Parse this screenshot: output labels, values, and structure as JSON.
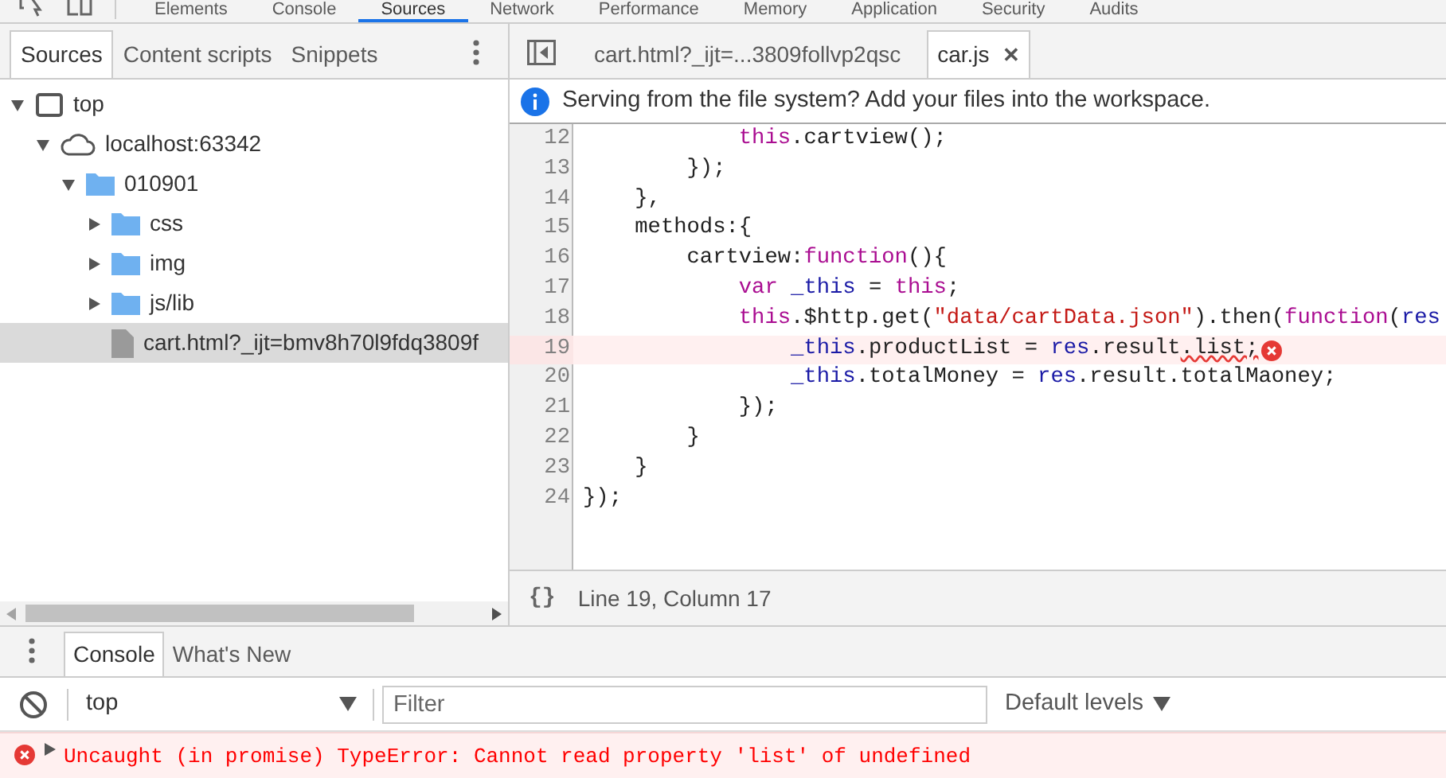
{
  "main_tabs": [
    {
      "label": "Elements",
      "selected": false
    },
    {
      "label": "Console",
      "selected": false
    },
    {
      "label": "Sources",
      "selected": true
    },
    {
      "label": "Network",
      "selected": false
    },
    {
      "label": "Performance",
      "selected": false
    },
    {
      "label": "Memory",
      "selected": false
    },
    {
      "label": "Application",
      "selected": false
    },
    {
      "label": "Security",
      "selected": false
    },
    {
      "label": "Audits",
      "selected": false
    }
  ],
  "navigator": {
    "tabs": [
      {
        "label": "Sources",
        "selected": true
      },
      {
        "label": "Content scripts",
        "selected": false
      },
      {
        "label": "Snippets",
        "selected": false
      }
    ],
    "tree": [
      {
        "kind": "frame",
        "label": "top",
        "expanded": true,
        "selected": false,
        "children": [
          {
            "kind": "domain",
            "label": "localhost:63342",
            "expanded": true,
            "selected": false,
            "children": [
              {
                "kind": "folder",
                "label": "010901",
                "expanded": true,
                "selected": false,
                "children": [
                  {
                    "kind": "folder",
                    "label": "css",
                    "expanded": false,
                    "selected": false
                  },
                  {
                    "kind": "folder",
                    "label": "img",
                    "expanded": false,
                    "selected": false
                  },
                  {
                    "kind": "folder",
                    "label": "js/lib",
                    "expanded": false,
                    "selected": false
                  },
                  {
                    "kind": "file",
                    "label": "cart.html?_ijt=bmv8h70l9fdq3809f",
                    "selected": true
                  }
                ]
              }
            ]
          }
        ]
      }
    ]
  },
  "editor": {
    "tabs": [
      {
        "label": "cart.html?_ijt=...3809follvp2qsc",
        "selected": false,
        "closable": false
      },
      {
        "label": "car.js",
        "selected": true,
        "closable": true
      }
    ],
    "close_glyph": "✕",
    "infobar": "Serving from the file system? Add your files into the workspace.",
    "lines": [
      {
        "number": "12",
        "error": false,
        "tokens": [
          {
            "kind": "keyword",
            "text": "            this"
          },
          {
            "kind": "plain",
            "text": ".cartview();"
          }
        ]
      },
      {
        "number": "13",
        "error": false,
        "tokens": [
          {
            "kind": "plain",
            "text": "        });"
          }
        ]
      },
      {
        "number": "14",
        "error": false,
        "tokens": [
          {
            "kind": "plain",
            "text": "    },"
          }
        ]
      },
      {
        "number": "15",
        "error": false,
        "tokens": [
          {
            "kind": "plain",
            "text": "    methods:{"
          }
        ]
      },
      {
        "number": "16",
        "error": false,
        "tokens": [
          {
            "kind": "plain",
            "text": "        cartview:"
          },
          {
            "kind": "keyword",
            "text": "function"
          },
          {
            "kind": "plain",
            "text": "(){"
          }
        ]
      },
      {
        "number": "17",
        "error": false,
        "tokens": [
          {
            "kind": "keyword",
            "text": "            var "
          },
          {
            "kind": "variable",
            "text": "_this"
          },
          {
            "kind": "plain",
            "text": " = "
          },
          {
            "kind": "keyword",
            "text": "this"
          },
          {
            "kind": "plain",
            "text": ";"
          }
        ]
      },
      {
        "number": "18",
        "error": false,
        "tokens": [
          {
            "kind": "keyword",
            "text": "            this"
          },
          {
            "kind": "plain",
            "text": ".$http.get("
          },
          {
            "kind": "string",
            "text": "\"data/cartData.json\""
          },
          {
            "kind": "plain",
            "text": ").then("
          },
          {
            "kind": "keyword",
            "text": "function"
          },
          {
            "kind": "plain",
            "text": "("
          },
          {
            "kind": "variable",
            "text": "res"
          }
        ]
      },
      {
        "number": "19",
        "error": true,
        "tokens": [
          {
            "kind": "variable",
            "text": "                _this"
          },
          {
            "kind": "plain",
            "text": ".productList = "
          },
          {
            "kind": "variable",
            "text": "res"
          },
          {
            "kind": "plain",
            "text": ".result"
          },
          {
            "kind": "squiggle",
            "text": ".list;"
          }
        ]
      },
      {
        "number": "20",
        "error": false,
        "tokens": [
          {
            "kind": "variable",
            "text": "                _this"
          },
          {
            "kind": "plain",
            "text": ".totalMoney = "
          },
          {
            "kind": "variable",
            "text": "res"
          },
          {
            "kind": "plain",
            "text": ".result.totalMaoney;"
          }
        ]
      },
      {
        "number": "21",
        "error": false,
        "tokens": [
          {
            "kind": "plain",
            "text": "            });"
          }
        ]
      },
      {
        "number": "22",
        "error": false,
        "tokens": [
          {
            "kind": "plain",
            "text": "        }"
          }
        ]
      },
      {
        "number": "23",
        "error": false,
        "tokens": [
          {
            "kind": "plain",
            "text": "    }"
          }
        ]
      },
      {
        "number": "24",
        "error": false,
        "tokens": [
          {
            "kind": "plain",
            "text": "});"
          }
        ]
      }
    ],
    "pretty_print": "{}",
    "status": "Line 19, Column 17"
  },
  "drawer": {
    "tabs": [
      {
        "label": "Console",
        "selected": true
      },
      {
        "label": "What's New",
        "selected": false
      }
    ],
    "context": "top",
    "filter_placeholder": "Filter",
    "levels": "Default levels",
    "messages": [
      {
        "kind": "error",
        "text": "Uncaught (in promise) TypeError: Cannot read property 'list' of undefined",
        "expanded": false
      }
    ]
  }
}
